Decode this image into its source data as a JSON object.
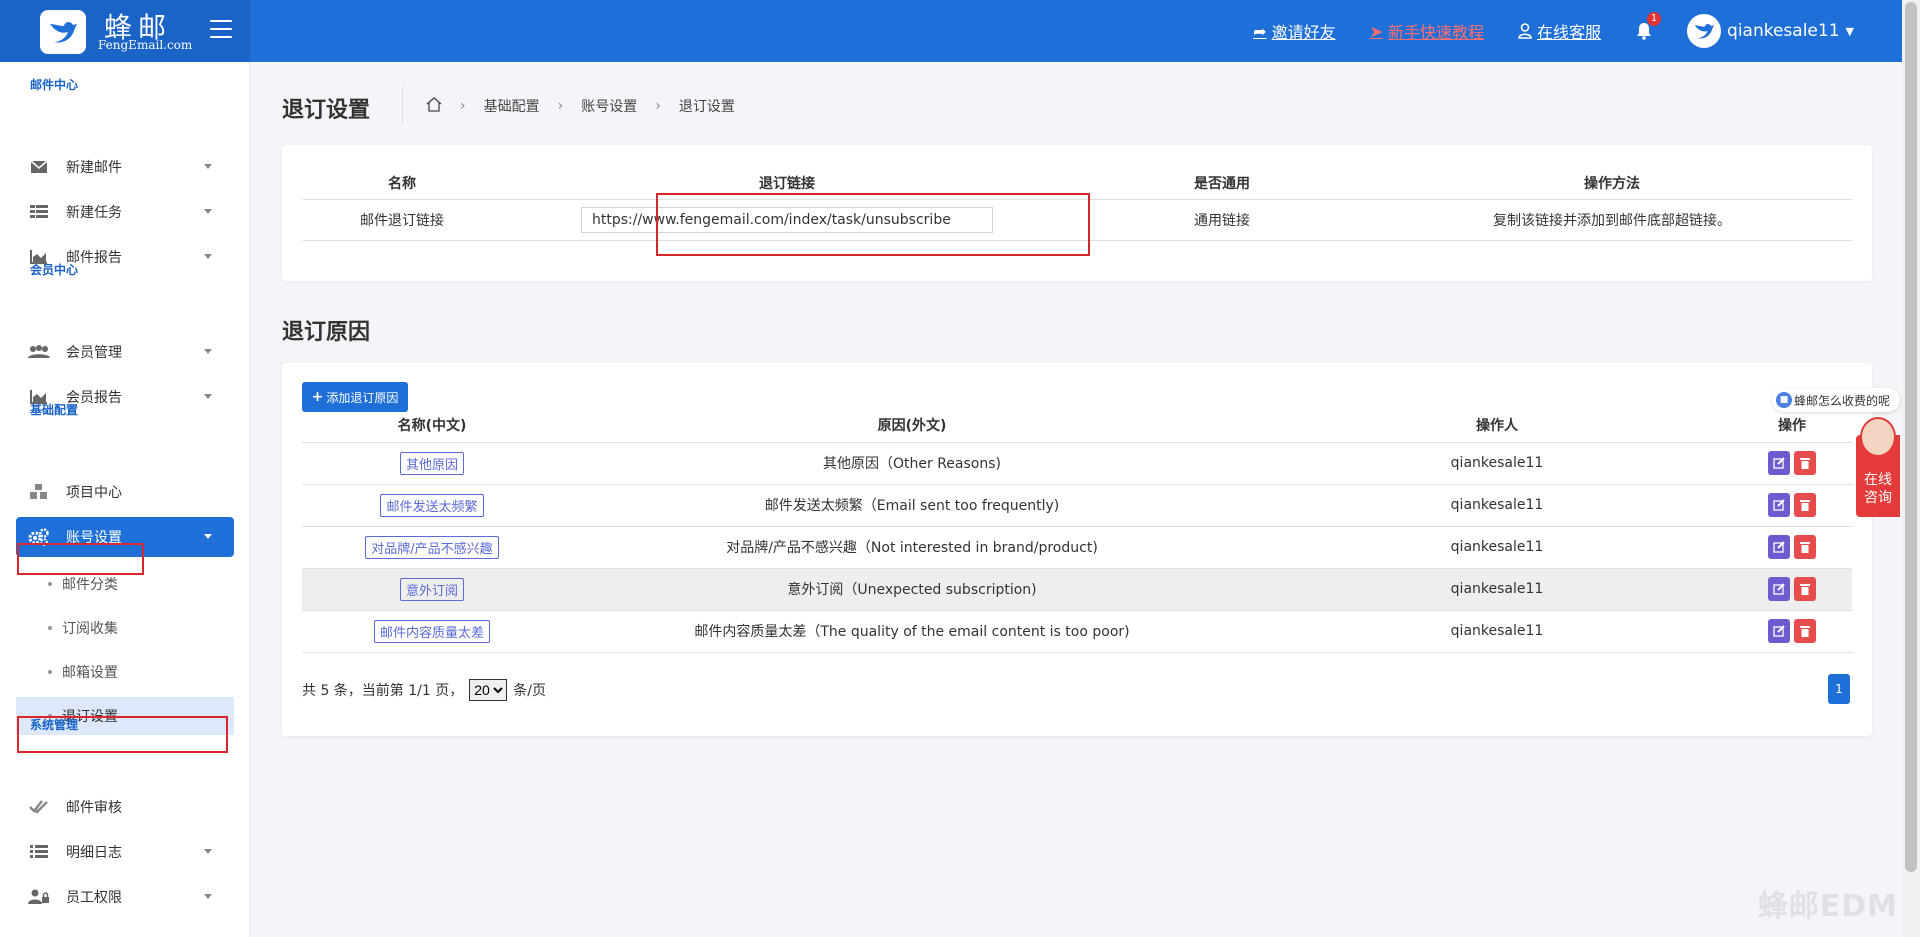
{
  "header": {
    "brand_name": "蜂邮",
    "brand_sub": "FengEmail.com",
    "links": [
      {
        "label": "邀请好友",
        "icon": "share-icon"
      },
      {
        "label": "新手快速教程",
        "icon": "rocket-icon"
      },
      {
        "label": "在线客服",
        "icon": "user-icon"
      }
    ],
    "notification_count": "1",
    "username": "qiankesale11"
  },
  "sidebar": {
    "sections": [
      "邮件中心",
      "会员中心",
      "基础配置",
      "系统管理"
    ],
    "items": {
      "new_email": "新建邮件",
      "new_task": "新建任务",
      "email_report": "邮件报告",
      "member_manage": "会员管理",
      "member_report": "会员报告",
      "project_center": "项目中心",
      "account_settings": "账号设置",
      "email_review": "邮件审核",
      "detail_log": "明细日志",
      "staff_perm": "员工权限"
    },
    "sub_items": [
      "邮件分类",
      "订阅收集",
      "邮箱设置",
      "退订设置"
    ]
  },
  "page": {
    "title": "退订设置",
    "breadcrumb": [
      "基础配置",
      "账号设置",
      "退订设置"
    ]
  },
  "unsubscribe_table": {
    "headers": [
      "名称",
      "退订链接",
      "是否通用",
      "操作方法"
    ],
    "row": {
      "name": "邮件退订链接",
      "link": "https://www.fengemail.com/index/task/unsubscribe",
      "general": "通用链接",
      "method": "复制该链接并添加到邮件底部超链接。"
    }
  },
  "reasons": {
    "title": "退订原因",
    "add_button": "添加退订原因",
    "headers": [
      "名称(中文)",
      "原因(外文)",
      "操作人",
      "操作"
    ],
    "rows": [
      {
        "name": "其他原因",
        "reason": "其他原因（Other Reasons)",
        "operator": "qiankesale11"
      },
      {
        "name": "邮件发送太频繁",
        "reason": "邮件发送太频繁（Email sent too frequently)",
        "operator": "qiankesale11"
      },
      {
        "name": "对品牌/产品不感兴趣",
        "reason": "对品牌/产品不感兴趣（Not interested in brand/product)",
        "operator": "qiankesale11"
      },
      {
        "name": "意外订阅",
        "reason": "意外订阅（Unexpected subscription)",
        "operator": "qiankesale11"
      },
      {
        "name": "邮件内容质量太差",
        "reason": "邮件内容质量太差（The quality of the email content is too poor)",
        "operator": "qiankesale11"
      }
    ],
    "pager": {
      "prefix": "共 5 条，当前第 1/1 页，",
      "page_size": "20",
      "suffix": "条/页",
      "current_page": "1"
    }
  },
  "widgets": {
    "bubble": "蜂邮怎么收费的呢",
    "consult": "在线咨询",
    "watermark": "蜂邮EDM"
  },
  "colors": {
    "primary": "#1f6fd8",
    "danger": "#e74c4c",
    "tag": "#5b6ad6",
    "highlight_box": "#d9252c"
  }
}
